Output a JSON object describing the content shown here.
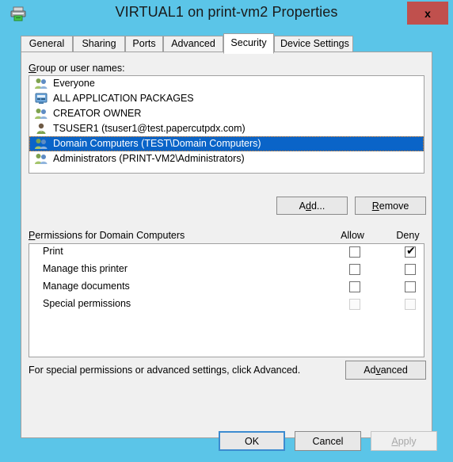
{
  "window": {
    "title": "VIRTUAL1 on print-vm2 Properties",
    "icon": "printer-icon",
    "close_label": "x",
    "titlebar_color": "#5BC5E8",
    "close_color": "#C0504D"
  },
  "tabs": [
    {
      "label": "General",
      "active": false
    },
    {
      "label": "Sharing",
      "active": false
    },
    {
      "label": "Ports",
      "active": false
    },
    {
      "label": "Advanced",
      "active": false
    },
    {
      "label": "Security",
      "active": true
    },
    {
      "label": "Device Settings",
      "active": false
    }
  ],
  "group_section": {
    "label_prefix": "G",
    "label_rest": "roup or user names:",
    "items": [
      {
        "name": "Everyone",
        "icon": "group-icon",
        "selected": false
      },
      {
        "name": "ALL APPLICATION PACKAGES",
        "icon": "app-packages-icon",
        "selected": false
      },
      {
        "name": "CREATOR OWNER",
        "icon": "group-icon",
        "selected": false
      },
      {
        "name": "TSUSER1 (tsuser1@test.papercutpdx.com)",
        "icon": "user-icon",
        "selected": false
      },
      {
        "name": "Domain Computers (TEST\\Domain Computers)",
        "icon": "group-icon",
        "selected": true
      },
      {
        "name": "Administrators (PRINT-VM2\\Administrators)",
        "icon": "group-icon",
        "selected": false
      }
    ],
    "selection_color": "#0A64C8"
  },
  "buttons": {
    "add": {
      "pre": "A",
      "accel": "d",
      "post": "d..."
    },
    "remove": {
      "accel": "R",
      "post": "emove"
    },
    "advanced": {
      "pre": "Ad",
      "accel": "v",
      "post": "anced"
    }
  },
  "permissions": {
    "header_accel": "P",
    "header_rest": "ermissions for Domain Computers",
    "col_allow": "Allow",
    "col_deny": "Deny",
    "rows": [
      {
        "name": "Print",
        "allow": false,
        "deny": true,
        "disabled": false
      },
      {
        "name": "Manage this printer",
        "allow": false,
        "deny": false,
        "disabled": false
      },
      {
        "name": "Manage documents",
        "allow": false,
        "deny": false,
        "disabled": false
      },
      {
        "name": "Special permissions",
        "allow": false,
        "deny": false,
        "disabled": true
      }
    ],
    "check_glyph": "✔"
  },
  "advanced_note": "For special permissions or advanced settings, click Advanced.",
  "footer": {
    "ok": "OK",
    "cancel": "Cancel",
    "apply": {
      "accel": "A",
      "post": "pply"
    },
    "apply_disabled": true
  }
}
